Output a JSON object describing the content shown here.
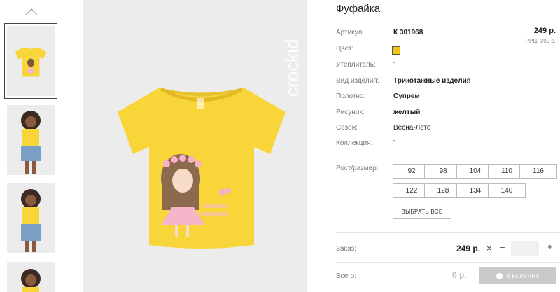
{
  "product": {
    "title": "Фуфайка",
    "price": "249 р.",
    "rrc": "РРЦ: 399 р.",
    "color_hex": "#f5c515",
    "brand": "crockid"
  },
  "attributes": [
    {
      "label": "Артикул:",
      "value": "К 301968",
      "bold": true
    },
    {
      "label": "Цвет:",
      "value": "",
      "swatch": true
    },
    {
      "label": "Утеплитель:",
      "value": "\""
    },
    {
      "label": "Вид изделия:",
      "value": "Трикотажные изделия",
      "bold": true
    },
    {
      "label": "Полотно:",
      "value": "Супрем",
      "bold": true
    },
    {
      "label": "Рисунок:",
      "value": "желтый",
      "bold": true
    },
    {
      "label": "Сезон:",
      "value": "Весна-Лето"
    },
    {
      "label": "Коллекция:",
      "value": "\""
    }
  ],
  "sizes": {
    "label": "Рост/размер:",
    "options": [
      "92",
      "98",
      "104",
      "110",
      "116",
      "122",
      "128",
      "134",
      "140"
    ],
    "select_all": "ВЫБРАТЬ ВСЕ"
  },
  "order": {
    "label": "Заказ:",
    "price": "249 р.",
    "times": "×",
    "minus": "−",
    "plus": "+"
  },
  "total": {
    "label": "Всего:",
    "value": "0 р.",
    "cart_button": "В КОРЗИНУ"
  }
}
